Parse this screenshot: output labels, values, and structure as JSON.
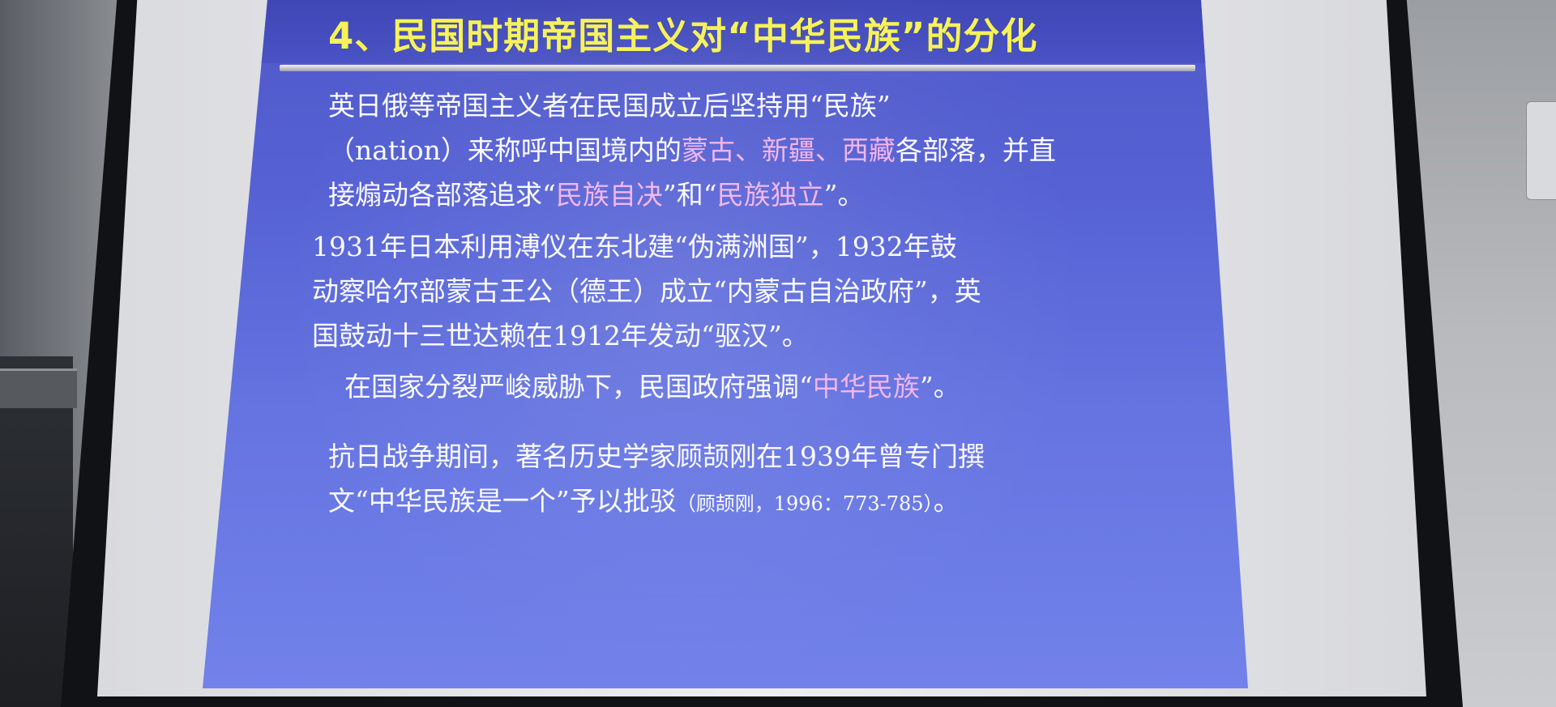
{
  "slide": {
    "title": "4、民国时期帝国主义对“中华民族”的分化",
    "paragraph_1": {
      "line_1": "英日俄等帝国主义者在民国成立后坚持用“民族”",
      "line_2_pre": "（nation）来称呼中国境内的",
      "line_2_em": "蒙古、新疆、西藏",
      "line_2_post": "各部落，并直",
      "line_3_pre": "接煽动各部落追求“",
      "line_3_em_1": "民族自决",
      "line_3_mid": "”和“",
      "line_3_em_2": "民族独立",
      "line_3_post": "”。"
    },
    "paragraph_2": {
      "line_1": "1931年日本利用溥仪在东北建“伪满洲国”，1932年鼓",
      "line_2": "动察哈尔部蒙古王公（德王）成立“内蒙古自治政府”，英",
      "line_3": "国鼓动十三世达赖在1912年发动“驱汉”。"
    },
    "paragraph_3": {
      "line_1_pre": "在国家分裂严峻威胁下，民国政府强调“",
      "line_1_em": "中华民族",
      "line_1_post": "”。"
    },
    "paragraph_4": {
      "line_1": "抗日战争期间，著名历史学家顾颉刚在1939年曾专门撰",
      "line_2_pre": "文“中华民族是一个”予以批驳",
      "line_2_cite": "（顾颉刚，1996：773-785）",
      "line_2_post": "。"
    }
  }
}
